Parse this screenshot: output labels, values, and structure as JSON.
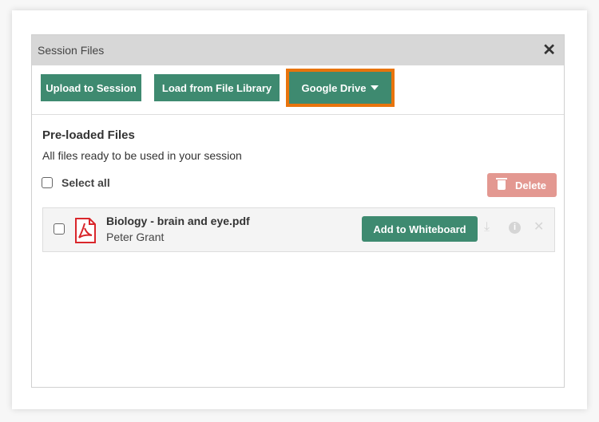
{
  "dialog": {
    "title": "Session Files",
    "close_icon": "close-icon"
  },
  "toolbar": {
    "upload_label": "Upload to Session",
    "library_label": "Load from File Library",
    "gdrive_label": "Google Drive",
    "highlight_color": "#e8740d",
    "button_color": "#3e8a70"
  },
  "section": {
    "heading": "Pre-loaded Files",
    "subtitle": "All files ready to be used in your session",
    "select_all_label": "Select all",
    "delete_label": "Delete"
  },
  "files": [
    {
      "name": "Biology - brain and eye.pdf",
      "owner": "Peter Grant",
      "type_icon": "pdf-icon",
      "action_label": "Add to Whiteboard"
    }
  ]
}
